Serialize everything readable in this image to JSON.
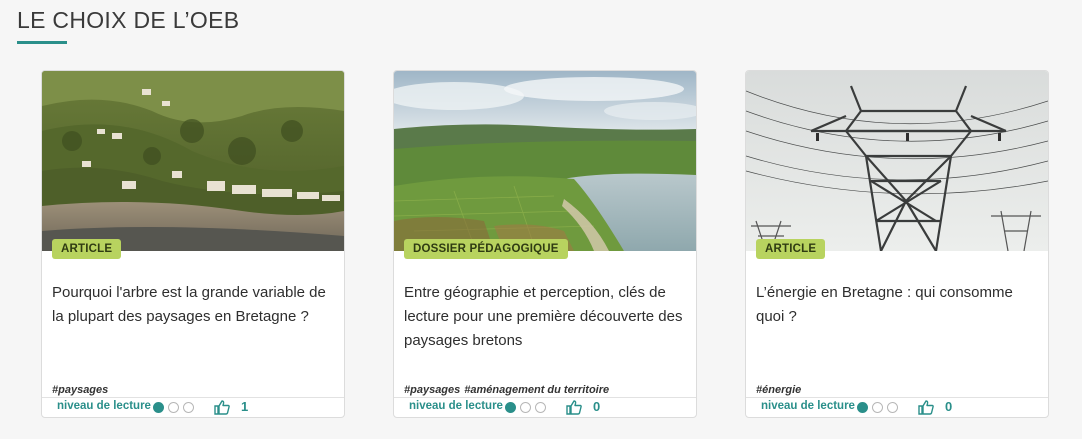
{
  "section": {
    "title": "LE CHOIX DE L’OEB"
  },
  "colors": {
    "accent": "#2a8f8a",
    "badge_bg": "#b8d35f",
    "background": "#f6f6f6"
  },
  "cards": [
    {
      "badge": "ARTICLE",
      "title": "Pourquoi l'arbre est la grande variable de la plupart des paysages en Bretagne ?",
      "tags": [
        "#paysages"
      ],
      "level_label": "niveau de lecture",
      "reading_level": 1,
      "reading_level_max": 3,
      "like_icon": "thumbs-up-icon",
      "likes": "1"
    },
    {
      "badge": "DOSSIER PÉDAGOGIQUE",
      "title": "Entre géographie et perception, clés de lecture pour une première découverte des paysages bretons",
      "tags": [
        "#paysages",
        "#aménagement du territoire"
      ],
      "level_label": "niveau de lecture",
      "reading_level": 1,
      "reading_level_max": 3,
      "like_icon": "thumbs-up-icon",
      "likes": "0"
    },
    {
      "badge": "ARTICLE",
      "title": "L’énergie en Bretagne : qui consomme quoi ?",
      "tags": [
        "#énergie"
      ],
      "level_label": "niveau de lecture",
      "reading_level": 1,
      "reading_level_max": 3,
      "like_icon": "thumbs-up-icon",
      "likes": "0"
    }
  ]
}
